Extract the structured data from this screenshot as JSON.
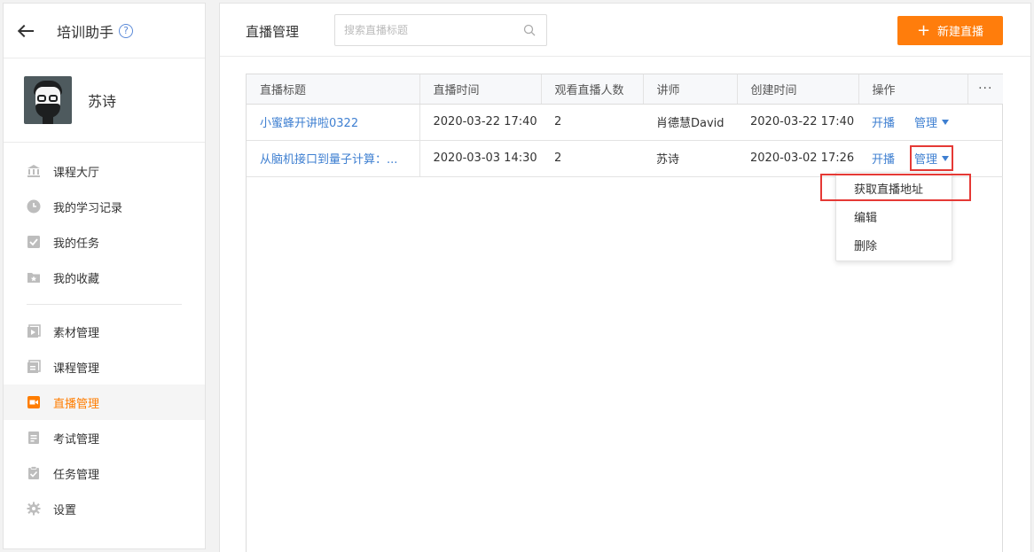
{
  "sidebar": {
    "title": "培训助手",
    "help": "?",
    "username": "苏诗",
    "items": [
      {
        "label": "课程大厅",
        "icon": "bank-icon"
      },
      {
        "label": "我的学习记录",
        "icon": "clock-icon"
      },
      {
        "label": "我的任务",
        "icon": "checkbox-icon"
      },
      {
        "label": "我的收藏",
        "icon": "star-folder-icon"
      },
      {
        "label": "素材管理",
        "icon": "media-icon"
      },
      {
        "label": "课程管理",
        "icon": "course-icon"
      },
      {
        "label": "直播管理",
        "icon": "live-camera-icon",
        "active": true
      },
      {
        "label": "考试管理",
        "icon": "exam-icon"
      },
      {
        "label": "任务管理",
        "icon": "task-icon"
      },
      {
        "label": "设置",
        "icon": "gear-icon"
      }
    ]
  },
  "header": {
    "title": "直播管理",
    "search_placeholder": "搜索直播标题",
    "new_button": "新建直播",
    "new_button_icon": "+"
  },
  "table": {
    "columns": [
      "直播标题",
      "直播时间",
      "观看直播人数",
      "讲师",
      "创建时间",
      "操作"
    ],
    "more": "···",
    "rows": [
      {
        "title": "小蜜蜂开讲啦0322",
        "time": "2020-03-22 17:40",
        "viewers": "2",
        "lecturer": "肖德慧David",
        "created": "2020-03-22 17:40",
        "start": "开播",
        "manage": "管理"
      },
      {
        "title": "从脑机接口到量子计算：...",
        "time": "2020-03-03 14:30",
        "viewers": "2",
        "lecturer": "苏诗",
        "created": "2020-03-02 17:26",
        "start": "开播",
        "manage": "管理"
      }
    ]
  },
  "dropdown": {
    "items": [
      "获取直播地址",
      "编辑",
      "删除"
    ]
  },
  "colors": {
    "accent": "#ff7d0c",
    "link": "#3e7fd1",
    "highlight": "#e53935"
  }
}
